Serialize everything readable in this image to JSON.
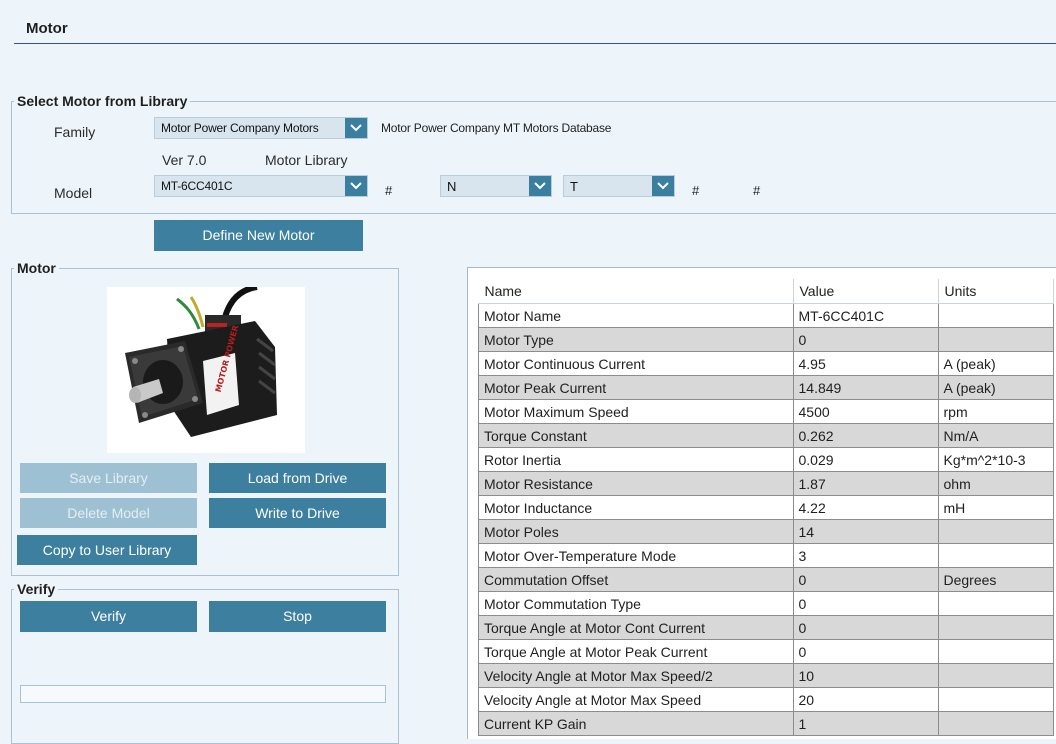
{
  "header": {
    "title": "Motor"
  },
  "select_library": {
    "legend": "Select Motor from Library",
    "family_label": "Family",
    "family_value": "Motor Power Company Motors",
    "family_description": "Motor Power Company MT Motors Database",
    "version": "Ver 7.0",
    "library_label": "Motor Library",
    "model_label": "Model",
    "model_value": "MT-6CC401C",
    "hash1": "#",
    "combo_n": "N",
    "combo_t": "T",
    "hash2": "#",
    "hash3": "#"
  },
  "define_new_motor": "Define New Motor",
  "motor_group": {
    "legend": "Motor",
    "save_library": "Save Library",
    "load_from_drive": "Load from Drive",
    "delete_model": "Delete Model",
    "write_to_drive": "Write to Drive",
    "copy_to_user_library": "Copy to User Library",
    "image_brand": "MOTOR POWER"
  },
  "verify_group": {
    "legend": "Verify",
    "verify": "Verify",
    "stop": "Stop",
    "progress": 0
  },
  "table": {
    "headers": {
      "name": "Name",
      "value": "Value",
      "units": "Units"
    },
    "rows": [
      {
        "name": "Motor Name",
        "value": "MT-6CC401C",
        "units": ""
      },
      {
        "name": "Motor Type",
        "value": "0",
        "units": ""
      },
      {
        "name": "Motor Continuous Current",
        "value": "4.95",
        "units": "A (peak)"
      },
      {
        "name": "Motor Peak Current",
        "value": "14.849",
        "units": "A (peak)"
      },
      {
        "name": "Motor Maximum Speed",
        "value": "4500",
        "units": "rpm"
      },
      {
        "name": "Torque Constant",
        "value": "0.262",
        "units": "Nm/A"
      },
      {
        "name": "Rotor Inertia",
        "value": "0.029",
        "units": "Kg*m^2*10-3"
      },
      {
        "name": "Motor Resistance",
        "value": "1.87",
        "units": "ohm"
      },
      {
        "name": "Motor Inductance",
        "value": "4.22",
        "units": "mH"
      },
      {
        "name": "Motor Poles",
        "value": "14",
        "units": ""
      },
      {
        "name": "Motor Over-Temperature Mode",
        "value": "3",
        "units": ""
      },
      {
        "name": "Commutation Offset",
        "value": "0",
        "units": "Degrees"
      },
      {
        "name": "Motor Commutation Type",
        "value": "0",
        "units": ""
      },
      {
        "name": "Torque Angle at Motor Cont Current",
        "value": "0",
        "units": ""
      },
      {
        "name": "Torque Angle at Motor Peak Current",
        "value": "0",
        "units": ""
      },
      {
        "name": "Velocity Angle at Motor Max Speed/2",
        "value": "10",
        "units": ""
      },
      {
        "name": "Velocity Angle at Motor Max Speed",
        "value": "20",
        "units": ""
      },
      {
        "name": "Current KP Gain",
        "value": "1",
        "units": ""
      }
    ]
  },
  "colors": {
    "accent_button": "#3d7f9f",
    "disabled_button": "#9dc1d2",
    "background": "#eef5fa",
    "row_alt": "#d8d8d8"
  }
}
